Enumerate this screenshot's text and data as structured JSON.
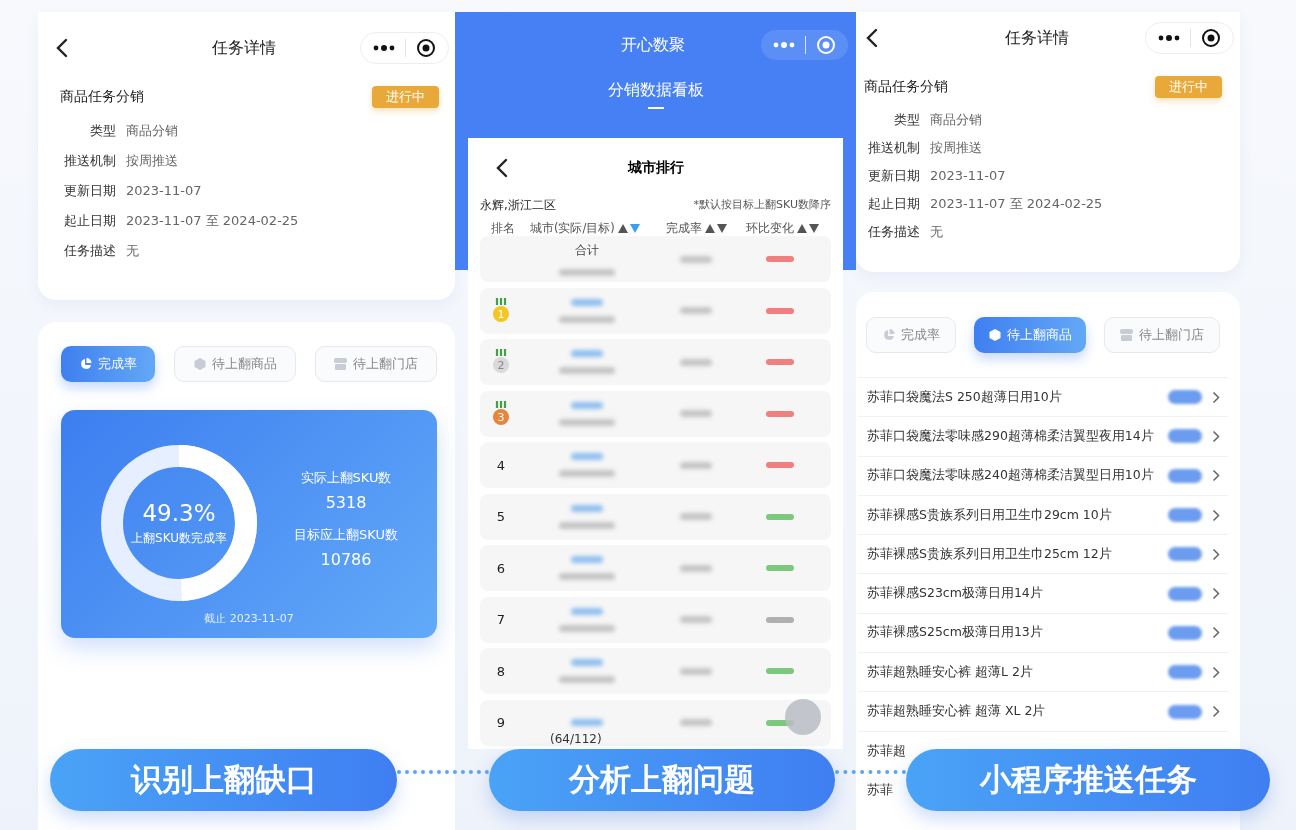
{
  "left": {
    "nav": {
      "title": "任务详情"
    },
    "task": {
      "name": "商品任务分销",
      "status": "进行中",
      "fields": [
        {
          "label": "类型",
          "value": "商品分销"
        },
        {
          "label": "推送机制",
          "value": "按周推送"
        },
        {
          "label": "更新日期",
          "value": "2023-11-07"
        },
        {
          "label": "起止日期",
          "value": "2023-11-07 至 2024-02-25"
        },
        {
          "label": "任务描述",
          "value": "无"
        }
      ]
    },
    "tabs": [
      {
        "label": "完成率",
        "selected": true
      },
      {
        "label": "待上翻商品",
        "selected": false
      },
      {
        "label": "待上翻门店",
        "selected": false
      }
    ],
    "summary": {
      "percent": "49.3%",
      "caption": "上翻SKU数完成率",
      "level": 0.493,
      "stats": [
        {
          "label": "实际上翻SKU数",
          "value": "5318"
        },
        {
          "label": "目标应上翻SKU数",
          "value": "10786"
        }
      ],
      "as_of": "截止 2023-11-07"
    }
  },
  "middle": {
    "app_title": "开心数聚",
    "page_tab": "分销数据看板",
    "ranking": {
      "title": "城市排行",
      "region": "永辉,浙江二区",
      "note": "*默认按目标上翻SKU数降序",
      "columns": [
        {
          "label": "排名",
          "sortable": false
        },
        {
          "label": "城市(实际/目标)",
          "sortable": true,
          "sorted": true
        },
        {
          "label": "完成率",
          "sortable": true,
          "sorted": false
        },
        {
          "label": "环比变化",
          "sortable": true,
          "sorted": false
        }
      ],
      "rows": [
        {
          "kind": "total",
          "rank": "合计",
          "color": "#f08080"
        },
        {
          "kind": "medal",
          "rank": "1",
          "color": "#f08080"
        },
        {
          "kind": "medal",
          "rank": "2",
          "color": "#f08080"
        },
        {
          "kind": "medal",
          "rank": "3",
          "color": "#f08080"
        },
        {
          "kind": "plain",
          "rank": "4",
          "color": "#f08080"
        },
        {
          "kind": "plain",
          "rank": "5",
          "color": "#7cc87c"
        },
        {
          "kind": "plain",
          "rank": "6",
          "color": "#7cc87c"
        },
        {
          "kind": "plain",
          "rank": "7",
          "color": "#b0b0b0"
        },
        {
          "kind": "plain",
          "rank": "8",
          "color": "#7cc87c"
        },
        {
          "kind": "plain",
          "rank": "9",
          "color": "#7cc87c",
          "fraction": "(64/112)"
        }
      ]
    }
  },
  "right": {
    "nav": {
      "title": "任务详情"
    },
    "task": {
      "name": "商品任务分销",
      "status": "进行中",
      "fields": [
        {
          "label": "类型",
          "value": "商品分销"
        },
        {
          "label": "推送机制",
          "value": "按周推送"
        },
        {
          "label": "更新日期",
          "value": "2023-11-07"
        },
        {
          "label": "起止日期",
          "value": "2023-11-07 至 2024-02-25"
        },
        {
          "label": "任务描述",
          "value": "无"
        }
      ]
    },
    "tabs": [
      {
        "label": "完成率",
        "selected": false
      },
      {
        "label": "待上翻商品",
        "selected": true
      },
      {
        "label": "待上翻门店",
        "selected": false
      }
    ],
    "products": [
      {
        "kind": "full",
        "name": "苏菲口袋魔法S 250超薄日用10片"
      },
      {
        "kind": "full",
        "name": "苏菲口袋魔法零味感290超薄棉柔洁翼型夜用14片"
      },
      {
        "kind": "full",
        "name": "苏菲口袋魔法零味感240超薄棉柔洁翼型日用10片"
      },
      {
        "kind": "full",
        "name": "苏菲裸感S贵族系列日用卫生巾29cm 10片"
      },
      {
        "kind": "full",
        "name": "苏菲裸感S贵族系列日用卫生巾25cm 12片"
      },
      {
        "kind": "full",
        "name": "苏菲裸感S23cm极薄日用14片"
      },
      {
        "kind": "full",
        "name": "苏菲裸感S25cm极薄日用13片"
      },
      {
        "kind": "full",
        "name": "苏菲超熟睡安心裤 超薄L 2片"
      },
      {
        "kind": "full",
        "name": "苏菲超熟睡安心裤 超薄 XL 2片"
      },
      {
        "kind": "cut",
        "name": "苏菲超"
      },
      {
        "kind": "cut",
        "name": "苏菲"
      }
    ]
  },
  "banners": [
    {
      "label": "识别上翻缺口"
    },
    {
      "label": "分析上翻问题"
    },
    {
      "label": "小程序推送任务"
    }
  ]
}
